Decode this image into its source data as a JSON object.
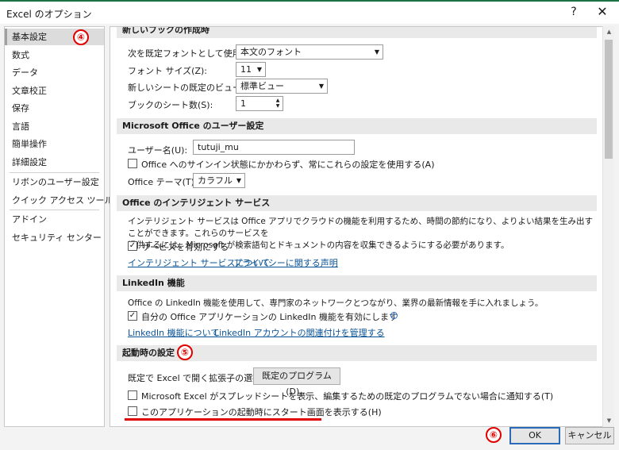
{
  "window": {
    "title": "Excel のオプション",
    "help": "?",
    "close": "✕"
  },
  "sidebar": {
    "items": [
      {
        "label": "基本設定"
      },
      {
        "label": "数式"
      },
      {
        "label": "データ"
      },
      {
        "label": "文章校正"
      },
      {
        "label": "保存"
      },
      {
        "label": "言語"
      },
      {
        "label": "簡単操作"
      },
      {
        "label": "詳細設定"
      },
      {
        "label": "リボンのユーザー設定"
      },
      {
        "label": "クイック アクセス ツール バー"
      },
      {
        "label": "アドイン"
      },
      {
        "label": "セキュリティ センター"
      }
    ]
  },
  "new_workbook": {
    "header": "新しいブックの作成時",
    "font_label": "次を既定フォントとして使用(N):",
    "font_value": "本文のフォント",
    "size_label": "フォント サイズ(Z):",
    "size_value": "11",
    "view_label": "新しいシートの既定のビュー(V):",
    "view_value": "標準ビュー",
    "sheets_label": "ブックのシート数(S):",
    "sheets_value": "1"
  },
  "user": {
    "header": "Microsoft Office のユーザー設定",
    "name_label": "ユーザー名(U):",
    "name_value": "tutuji_mu",
    "always_use_label": "Office へのサインイン状態にかかわらず、常にこれらの設定を使用する(A)",
    "always_use_checked": false,
    "theme_label": "Office テーマ(T):",
    "theme_value": "カラフル"
  },
  "intelligent": {
    "header": "Office のインテリジェント サービス",
    "description_line1": "インテリジェント サービスは Office アプリでクラウドの機能を利用するため、時間の節約になり、よりよい結果を生み出すことができます。これらのサービスを",
    "description_line2": "提供するには、Microsoft が検索語句とドキュメントの内容を収集できるようにする必要があります。",
    "enable_label": "サービスを有効にする",
    "enable_checked": true,
    "link_about": "インテリジェント サービスについて",
    "link_privacy": "プライバシーに関する声明"
  },
  "linkedin": {
    "header": "LinkedIn 機能",
    "description": "Office の LinkedIn 機能を使用して、専門家のネットワークとつながり、業界の最新情報を手に入れましょう。",
    "enable_label": "自分の Office アプリケーションの LinkedIn 機能を有効にします",
    "enable_checked": true,
    "link_about": "LinkedIn 機能について",
    "link_manage": "LinkedIn アカウントの関連付けを管理する"
  },
  "startup": {
    "header": "起動時の設定",
    "extensions_label": "既定で Excel で開く拡張子の選択:",
    "default_programs_button": "既定のプログラム(D)...",
    "notify_label": "Microsoft Excel がスプレッドシートを表示、編集するための既定のプログラムでない場合に通知する(T)",
    "notify_checked": false,
    "start_screen_label": "このアプリケーションの起動時にスタート画面を表示する(H)",
    "start_screen_checked": false
  },
  "footer": {
    "ok": "OK",
    "cancel": "キャンセル"
  },
  "annotations": {
    "marker4": "④",
    "marker5": "⑤",
    "marker6": "⑥"
  },
  "icons": {
    "dropdown": "▼",
    "check": "✓",
    "spin_up": "▲",
    "spin_down": "▼",
    "info": "i",
    "scroll_up": "▲",
    "scroll_down": "▼"
  }
}
